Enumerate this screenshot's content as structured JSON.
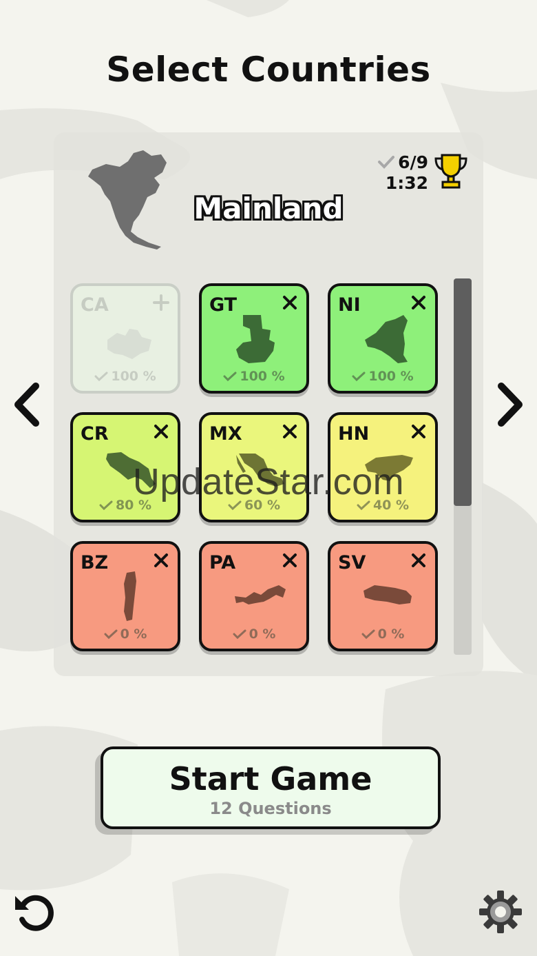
{
  "page": {
    "title": "Select Countries"
  },
  "region": {
    "name": "Mainland",
    "progress": "6/9",
    "time": "1:32"
  },
  "countries": [
    {
      "code": "CA",
      "percent": "100 %",
      "state": "disabled",
      "action": "+",
      "color": "#e8f0e2"
    },
    {
      "code": "GT",
      "percent": "100 %",
      "state": "selected",
      "action": "×",
      "color": "#8ef07a"
    },
    {
      "code": "NI",
      "percent": "100 %",
      "state": "selected",
      "action": "×",
      "color": "#8ef07a"
    },
    {
      "code": "CR",
      "percent": "80 %",
      "state": "selected",
      "action": "×",
      "color": "#d6f573"
    },
    {
      "code": "MX",
      "percent": "60 %",
      "state": "selected",
      "action": "×",
      "color": "#eaf67c"
    },
    {
      "code": "HN",
      "percent": "40 %",
      "state": "selected",
      "action": "×",
      "color": "#f5f27d"
    },
    {
      "code": "BZ",
      "percent": "0 %",
      "state": "selected",
      "action": "×",
      "color": "#f79a80"
    },
    {
      "code": "PA",
      "percent": "0 %",
      "state": "selected",
      "action": "×",
      "color": "#f79a80"
    },
    {
      "code": "SV",
      "percent": "0 %",
      "state": "selected",
      "action": "×",
      "color": "#f79a80"
    }
  ],
  "start": {
    "label": "Start Game",
    "sub": "12 Questions"
  },
  "watermark": "UpdateStar.com",
  "icons": {
    "prev": "chevron-left-icon",
    "next": "chevron-right-icon",
    "undo": "undo-icon",
    "settings": "gear-icon",
    "trophy": "trophy-icon"
  },
  "colors": {
    "trophy": "#f4d000",
    "scroll_thumb": "#5e5e5e"
  }
}
